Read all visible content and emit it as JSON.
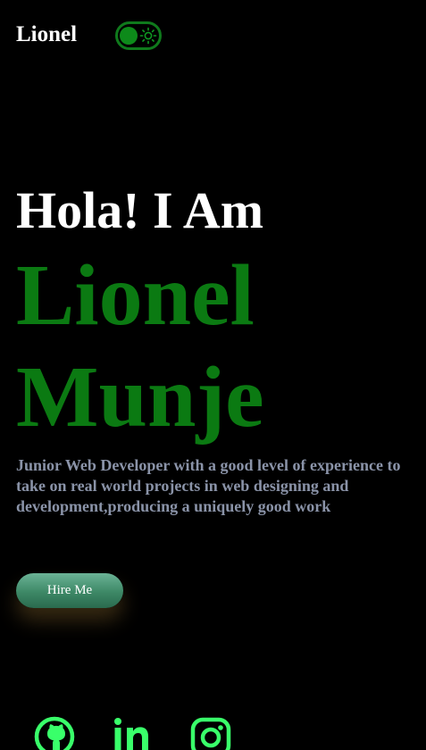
{
  "header": {
    "logo": "Lionel",
    "theme_toggle": {
      "state": "dark"
    }
  },
  "hero": {
    "greeting": "Hola! I Am",
    "name_first": "Lionel",
    "name_last": "Munje",
    "description": "Junior Web Developer with a good level of experience to take on real world projects in web designing and development,producing a uniquely good work",
    "cta_label": "Hire Me"
  },
  "social_links": [
    {
      "icon": "github-icon"
    },
    {
      "icon": "linkedin-icon"
    },
    {
      "icon": "instagram-icon"
    }
  ],
  "colors": {
    "background": "#000000",
    "accent": "#0b7a12",
    "text": "#ffffff",
    "muted_text": "#8a93a8",
    "social_icon": "#39ff6a",
    "button": "#3d8866"
  }
}
